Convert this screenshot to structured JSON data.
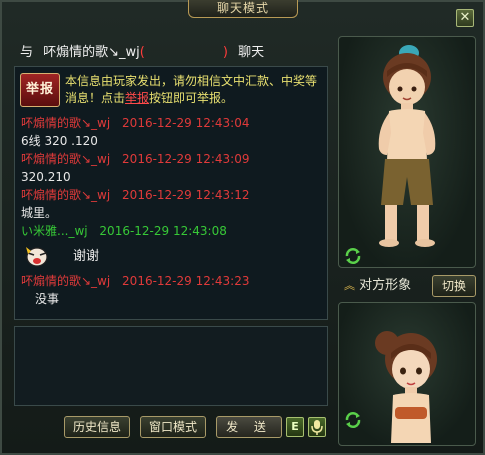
{
  "window": {
    "title": "聊天模式",
    "close_label": "✕"
  },
  "header": {
    "prefix": "与",
    "name": "吥煽情的歌↘_wj",
    "paren_open": "(",
    "paren_close": ")",
    "suffix": "聊天"
  },
  "notice": {
    "report_label": "举报",
    "text_before": "本信息由玩家发出，请勿相信文中汇款、中奖等消息！点击",
    "link_text": "举报",
    "text_after": "按钮即可举报。"
  },
  "messages": [
    {
      "sender": "吥煽情的歌↘_wj",
      "time": "2016-12-29 12:43:04",
      "text": "6线 320 .120",
      "sender_color": "red"
    },
    {
      "sender": "吥煽情的歌↘_wj",
      "time": "2016-12-29 12:43:09",
      "text": "320.210",
      "sender_color": "red"
    },
    {
      "sender": "吥煽情的歌↘_wj",
      "time": "2016-12-29 12:43:12",
      "text": "城里。",
      "sender_color": "red"
    },
    {
      "sender": "い米雅..._wj",
      "time": "2016-12-29 12:43:08",
      "text": "谢谢",
      "sender_color": "green"
    },
    {
      "sender": "吥煽情的歌↘_wj",
      "time": "2016-12-29 12:43:23",
      "text": "没事",
      "sender_color": "red"
    }
  ],
  "buttons": {
    "history": "历史信息",
    "window_mode": "窗口模式",
    "send": "发 送",
    "emote": "E"
  },
  "side": {
    "label": "对方形象",
    "switch": "切换"
  },
  "icons": [
    "close-icon",
    "emoji-icon",
    "refresh-icon",
    "chevron-up-icon",
    "microphone-icon"
  ],
  "colors": {
    "accent_gold": "#b89a55",
    "name_red": "#e03a3a",
    "name_green": "#37c837",
    "notice_yellow": "#e8e070"
  }
}
